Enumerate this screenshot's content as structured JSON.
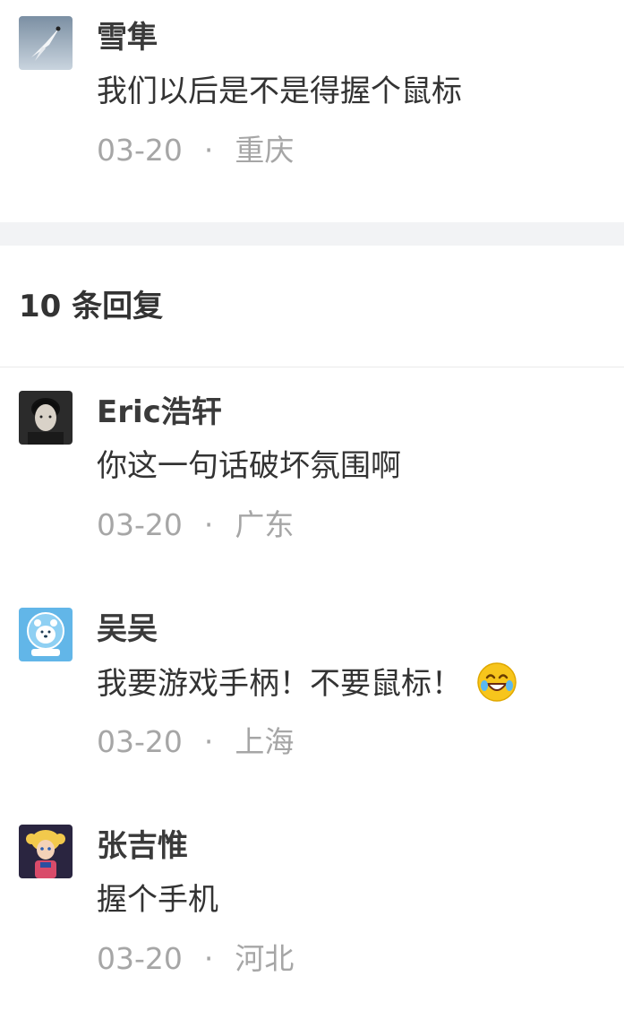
{
  "main_comment": {
    "author": "雪隼",
    "text": "我们以后是不是得握个鼠标",
    "date": "03-20",
    "separator": "·",
    "location": "重庆"
  },
  "replies_header": "10 条回复",
  "replies": [
    {
      "author": "Eric浩轩",
      "text": "你这一句话破坏氛围啊",
      "date": "03-20",
      "separator": "·",
      "location": "广东"
    },
    {
      "author": "吴吴",
      "text": "我要游戏手柄！不要鼠标！",
      "emoji": "laughing-crying-emoji",
      "date": "03-20",
      "separator": "·",
      "location": "上海"
    },
    {
      "author": "张吉惟",
      "text": "握个手机",
      "date": "03-20",
      "separator": "·",
      "location": "河北"
    }
  ],
  "colors": {
    "name": "#3a3a3a",
    "text": "#333333",
    "meta": "#a6a6a6",
    "band": "#f2f3f5",
    "divider": "#eaeaea"
  }
}
